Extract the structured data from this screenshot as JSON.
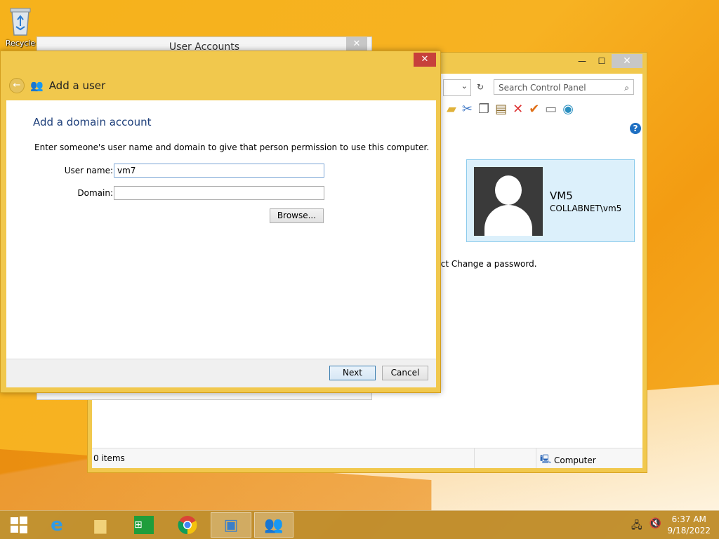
{
  "desktop": {
    "recycle_label": "Recycle"
  },
  "control_panel": {
    "search_placeholder": "Search Control Panel",
    "user_tile": {
      "name": "VM5",
      "domain": "COLLABNET\\vm5"
    },
    "instruction_fragment": "lect Change a password.",
    "status": {
      "items": "0 items",
      "location": "Computer"
    },
    "buttons": {
      "minimize": "—",
      "maximize": "☐",
      "close": "✕"
    }
  },
  "user_accounts": {
    "title": "User Accounts",
    "close": "✕"
  },
  "dialog": {
    "close": "✕",
    "nav_title": "Add a user",
    "heading": "Add a domain account",
    "description": "Enter someone's user name and domain to give that person permission to use this computer.",
    "username_label": "User name:",
    "username_value": "vm7",
    "domain_label": "Domain:",
    "domain_value": "",
    "browse_label": "Browse...",
    "next_label": "Next",
    "cancel_label": "Cancel"
  },
  "taskbar": {
    "time": "6:37 AM",
    "date": "9/18/2022",
    "items": [
      "start",
      "internet-explorer",
      "file-explorer",
      "store",
      "chrome",
      "control-panel",
      "user-accounts"
    ]
  },
  "colors": {
    "accent": "#f1c84d",
    "close_red": "#c7403b",
    "heading_blue": "#1e3f7a"
  }
}
